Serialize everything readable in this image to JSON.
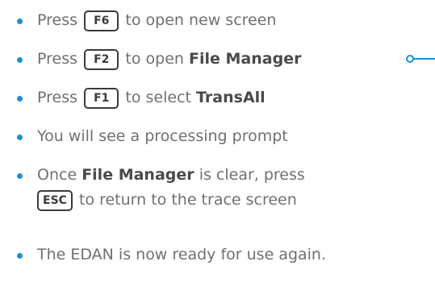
{
  "steps": [
    {
      "pre": "Press",
      "key": "F6",
      "post": "to open new screen"
    },
    {
      "pre": "Press",
      "key": "F2",
      "post": "to open",
      "bold": "File Manager"
    },
    {
      "pre": "Press",
      "key": "F1",
      "post": "to select",
      "bold": "TransAll"
    },
    {
      "text": "You will see a processing prompt"
    },
    {
      "pre": "Once",
      "bold": "File Manager",
      "post": "is clear, press",
      "key": "ESC",
      "line2": "to return to the trace screen"
    },
    {
      "text": "The EDAN is now ready for use again."
    }
  ],
  "colors": {
    "bullet": "#1b8fd4",
    "text": "#6f6f6f",
    "key_border": "#3a3a3a",
    "connector": "#1b8fd4"
  },
  "connector_icon": "callout-connector-icon"
}
